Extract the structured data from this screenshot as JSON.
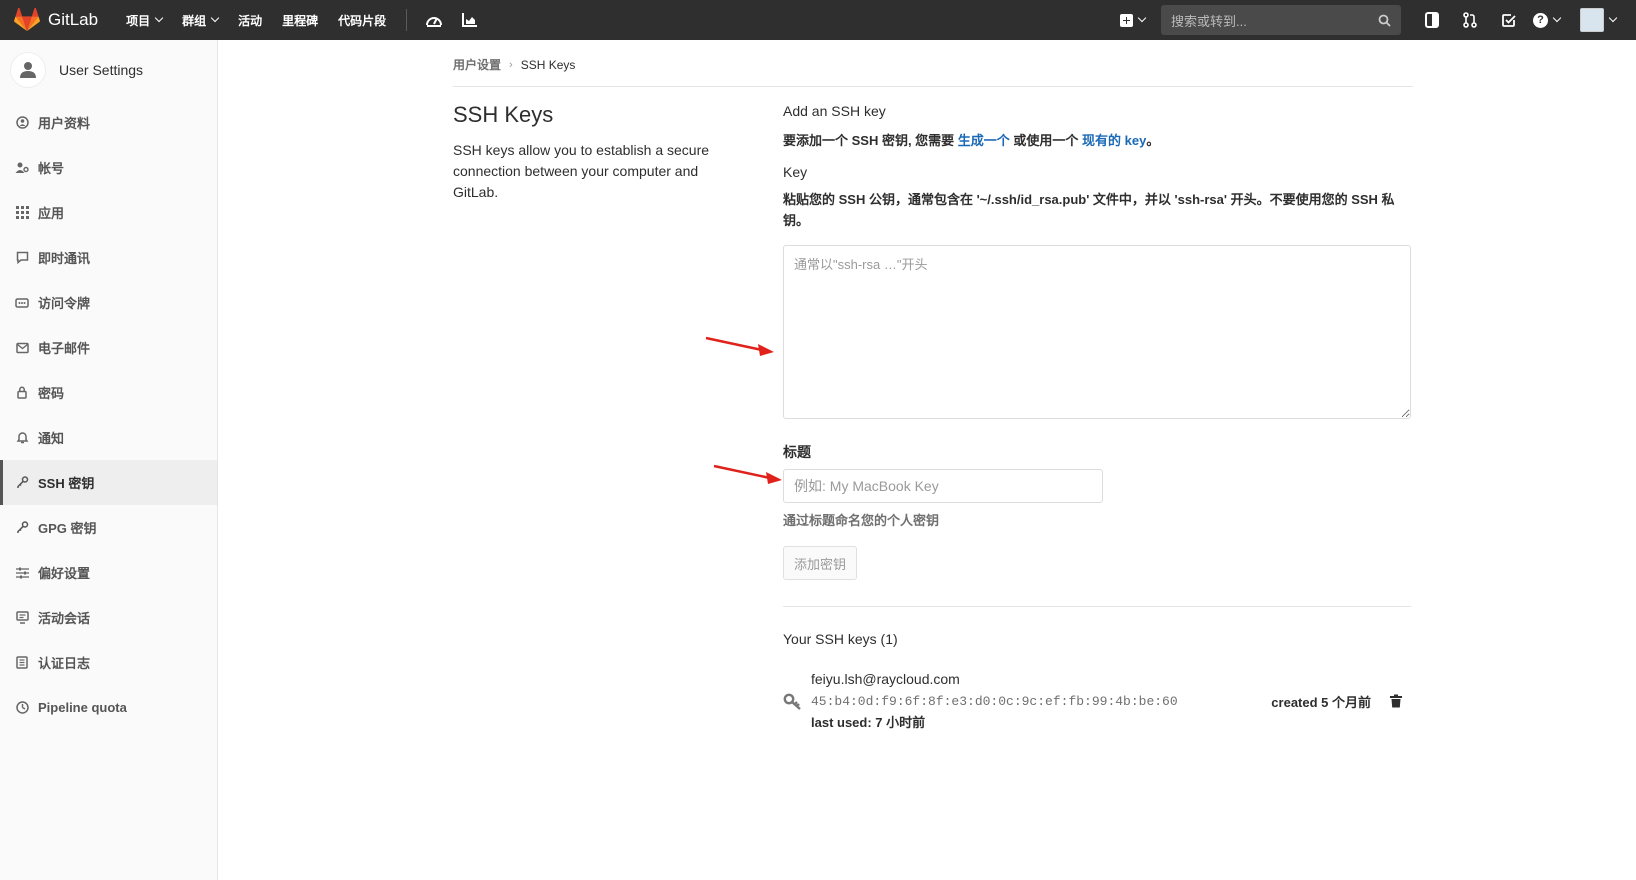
{
  "navbar": {
    "app_name": "GitLab",
    "items": [
      {
        "label": "项目",
        "caret": true
      },
      {
        "label": "群组",
        "caret": true
      },
      {
        "label": "活动",
        "caret": false
      },
      {
        "label": "里程碑",
        "caret": false
      },
      {
        "label": "代码片段",
        "caret": false
      }
    ],
    "icons_left": [
      "dashboard-icon",
      "chart-icon"
    ],
    "search_placeholder": "搜索或转到...",
    "icons_right": [
      "sidebar-toggle-icon",
      "merge-request-icon",
      "todo-check-icon"
    ],
    "colors": {
      "bar": "#2f2f2f",
      "logo_orange": "#e24329"
    }
  },
  "sidebar": {
    "title": "User Settings",
    "items": [
      {
        "label": "用户资料",
        "icon": "profile-icon"
      },
      {
        "label": "帐号",
        "icon": "account-icon"
      },
      {
        "label": "应用",
        "icon": "applications-icon"
      },
      {
        "label": "即时通讯",
        "icon": "chat-icon"
      },
      {
        "label": "访问令牌",
        "icon": "token-icon"
      },
      {
        "label": "电子邮件",
        "icon": "email-icon"
      },
      {
        "label": "密码",
        "icon": "lock-icon"
      },
      {
        "label": "通知",
        "icon": "bell-icon"
      },
      {
        "label": "SSH 密钥",
        "icon": "key-icon",
        "active": true
      },
      {
        "label": "GPG 密钥",
        "icon": "key-icon"
      },
      {
        "label": "偏好设置",
        "icon": "preferences-icon"
      },
      {
        "label": "活动会话",
        "icon": "sessions-icon"
      },
      {
        "label": "认证日志",
        "icon": "log-icon"
      },
      {
        "label": "Pipeline quota",
        "icon": "quota-icon"
      }
    ]
  },
  "breadcrumb": {
    "parent": "用户设置",
    "current": "SSH Keys"
  },
  "intro": {
    "title": "SSH Keys",
    "description": "SSH keys allow you to establish a secure connection between your computer and GitLab."
  },
  "form": {
    "add_title": "Add an SSH key",
    "add_hint_prefix": "要添加一个 SSH 密钥, 您需要 ",
    "add_hint_link1": "生成一个",
    "add_hint_middle": " 或使用一个 ",
    "add_hint_link2": "现有的 key",
    "add_hint_suffix": "。",
    "key_label": "Key",
    "key_hint": "粘贴您的 SSH 公钥，通常包含在 '~/.ssh/id_rsa.pub' 文件中，并以 'ssh-rsa' 开头。不要使用您的 SSH 私钥。",
    "key_placeholder": "通常以\"ssh-rsa …\"开头",
    "title_label": "标题",
    "title_placeholder": "例如: My MacBook Key",
    "title_hint": "通过标题命名您的个人密钥",
    "submit_label": "添加密钥"
  },
  "keys": {
    "heading": "Your SSH keys (1)",
    "list": [
      {
        "email": "feiyu.lsh@raycloud.com",
        "fingerprint": "45:b4:0d:f9:6f:8f:e3:d0:0c:9c:ef:fb:99:4b:be:60",
        "last_used": "last used: 7 小时前",
        "created": "created 5 个月前"
      }
    ]
  },
  "annotations": {
    "arrow_color": "#e0221b"
  }
}
